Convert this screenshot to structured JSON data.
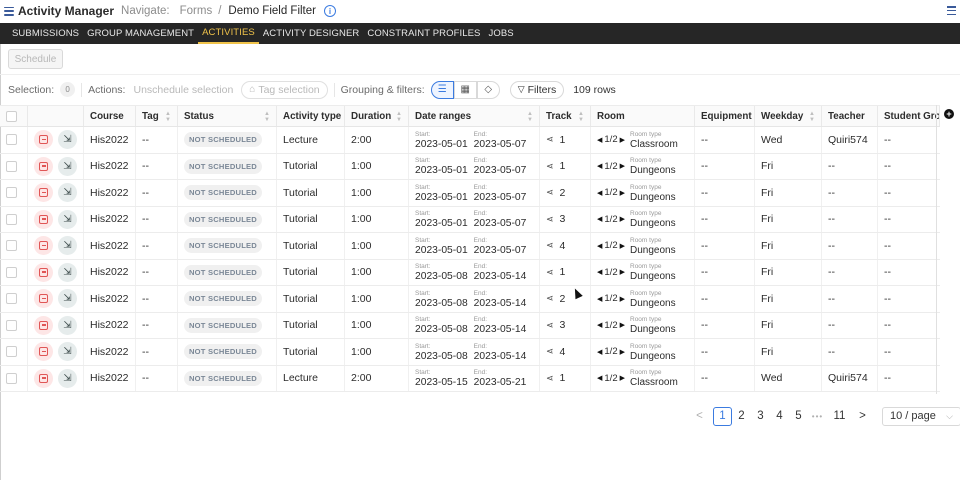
{
  "header": {
    "app_title": "Activity Manager",
    "navigate_label": "Navigate:",
    "breadcrumb_parent": "Forms",
    "breadcrumb_sep": "/",
    "breadcrumb_current": "Demo Field Filter",
    "info_glyph": "i"
  },
  "tabs": [
    "SUBMISSIONS",
    "GROUP MANAGEMENT",
    "ACTIVITIES",
    "ACTIVITY DESIGNER",
    "CONSTRAINT PROFILES",
    "JOBS"
  ],
  "active_tab": "ACTIVITIES",
  "schedule_button": "Schedule",
  "toolbar": {
    "selection_label": "Selection:",
    "selection_count": "0",
    "actions_label": "Actions:",
    "unschedule_label": "Unschedule selection",
    "tag_label": "Tag selection",
    "grouping_label": "Grouping & filters:",
    "filters_label": "Filters",
    "rows_label": "109 rows"
  },
  "columns": [
    "Course",
    "Tag",
    "Status",
    "Activity type",
    "Duration",
    "Date ranges",
    "Track",
    "Room",
    "Equipment",
    "Weekday",
    "Teacher",
    "Student Gro"
  ],
  "labels": {
    "start": "Start:",
    "end": "End:",
    "room_type": "Room type",
    "room_pos": "1/2"
  },
  "rows": [
    {
      "course": "His2022",
      "tag": "--",
      "status": "NOT SCHEDULED",
      "type": "Lecture",
      "duration": "2:00",
      "start": "2023-05-01",
      "end": "2023-05-07",
      "track": "1",
      "room": "Classroom",
      "equipment": "--",
      "weekday": "Wed",
      "teacher": "Quiri574",
      "group": "--"
    },
    {
      "course": "His2022",
      "tag": "--",
      "status": "NOT SCHEDULED",
      "type": "Tutorial",
      "duration": "1:00",
      "start": "2023-05-01",
      "end": "2023-05-07",
      "track": "1",
      "room": "Dungeons",
      "equipment": "--",
      "weekday": "Fri",
      "teacher": "--",
      "group": "--"
    },
    {
      "course": "His2022",
      "tag": "--",
      "status": "NOT SCHEDULED",
      "type": "Tutorial",
      "duration": "1:00",
      "start": "2023-05-01",
      "end": "2023-05-07",
      "track": "2",
      "room": "Dungeons",
      "equipment": "--",
      "weekday": "Fri",
      "teacher": "--",
      "group": "--"
    },
    {
      "course": "His2022",
      "tag": "--",
      "status": "NOT SCHEDULED",
      "type": "Tutorial",
      "duration": "1:00",
      "start": "2023-05-01",
      "end": "2023-05-07",
      "track": "3",
      "room": "Dungeons",
      "equipment": "--",
      "weekday": "Fri",
      "teacher": "--",
      "group": "--"
    },
    {
      "course": "His2022",
      "tag": "--",
      "status": "NOT SCHEDULED",
      "type": "Tutorial",
      "duration": "1:00",
      "start": "2023-05-01",
      "end": "2023-05-07",
      "track": "4",
      "room": "Dungeons",
      "equipment": "--",
      "weekday": "Fri",
      "teacher": "--",
      "group": "--"
    },
    {
      "course": "His2022",
      "tag": "--",
      "status": "NOT SCHEDULED",
      "type": "Tutorial",
      "duration": "1:00",
      "start": "2023-05-08",
      "end": "2023-05-14",
      "track": "1",
      "room": "Dungeons",
      "equipment": "--",
      "weekday": "Fri",
      "teacher": "--",
      "group": "--"
    },
    {
      "course": "His2022",
      "tag": "--",
      "status": "NOT SCHEDULED",
      "type": "Tutorial",
      "duration": "1:00",
      "start": "2023-05-08",
      "end": "2023-05-14",
      "track": "2",
      "room": "Dungeons",
      "equipment": "--",
      "weekday": "Fri",
      "teacher": "--",
      "group": "--"
    },
    {
      "course": "His2022",
      "tag": "--",
      "status": "NOT SCHEDULED",
      "type": "Tutorial",
      "duration": "1:00",
      "start": "2023-05-08",
      "end": "2023-05-14",
      "track": "3",
      "room": "Dungeons",
      "equipment": "--",
      "weekday": "Fri",
      "teacher": "--",
      "group": "--"
    },
    {
      "course": "His2022",
      "tag": "--",
      "status": "NOT SCHEDULED",
      "type": "Tutorial",
      "duration": "1:00",
      "start": "2023-05-08",
      "end": "2023-05-14",
      "track": "4",
      "room": "Dungeons",
      "equipment": "--",
      "weekday": "Fri",
      "teacher": "--",
      "group": "--"
    },
    {
      "course": "His2022",
      "tag": "--",
      "status": "NOT SCHEDULED",
      "type": "Lecture",
      "duration": "2:00",
      "start": "2023-05-15",
      "end": "2023-05-21",
      "track": "1",
      "room": "Classroom",
      "equipment": "--",
      "weekday": "Wed",
      "teacher": "Quiri574",
      "group": "--"
    }
  ],
  "pagination": {
    "prev": "<",
    "pages": [
      "1",
      "2",
      "3",
      "4",
      "5"
    ],
    "dots": "•••",
    "last": "11",
    "next": ">",
    "current": "1",
    "page_size": "10 / page"
  },
  "icons": {
    "menu": "hamburger-icon",
    "info": "info-icon",
    "unschedule": "unschedule-icon",
    "open": "open-external-icon",
    "share": "share-icon",
    "list": "list-icon",
    "calendar": "calendar-icon",
    "tag": "tag-icon",
    "filter": "filter-icon",
    "add": "add-column-icon"
  },
  "colors": {
    "accent": "#3b7be0",
    "active_tab": "#f0c34a",
    "tabbar_bg": "#262626",
    "unschedule": "#e05555"
  }
}
